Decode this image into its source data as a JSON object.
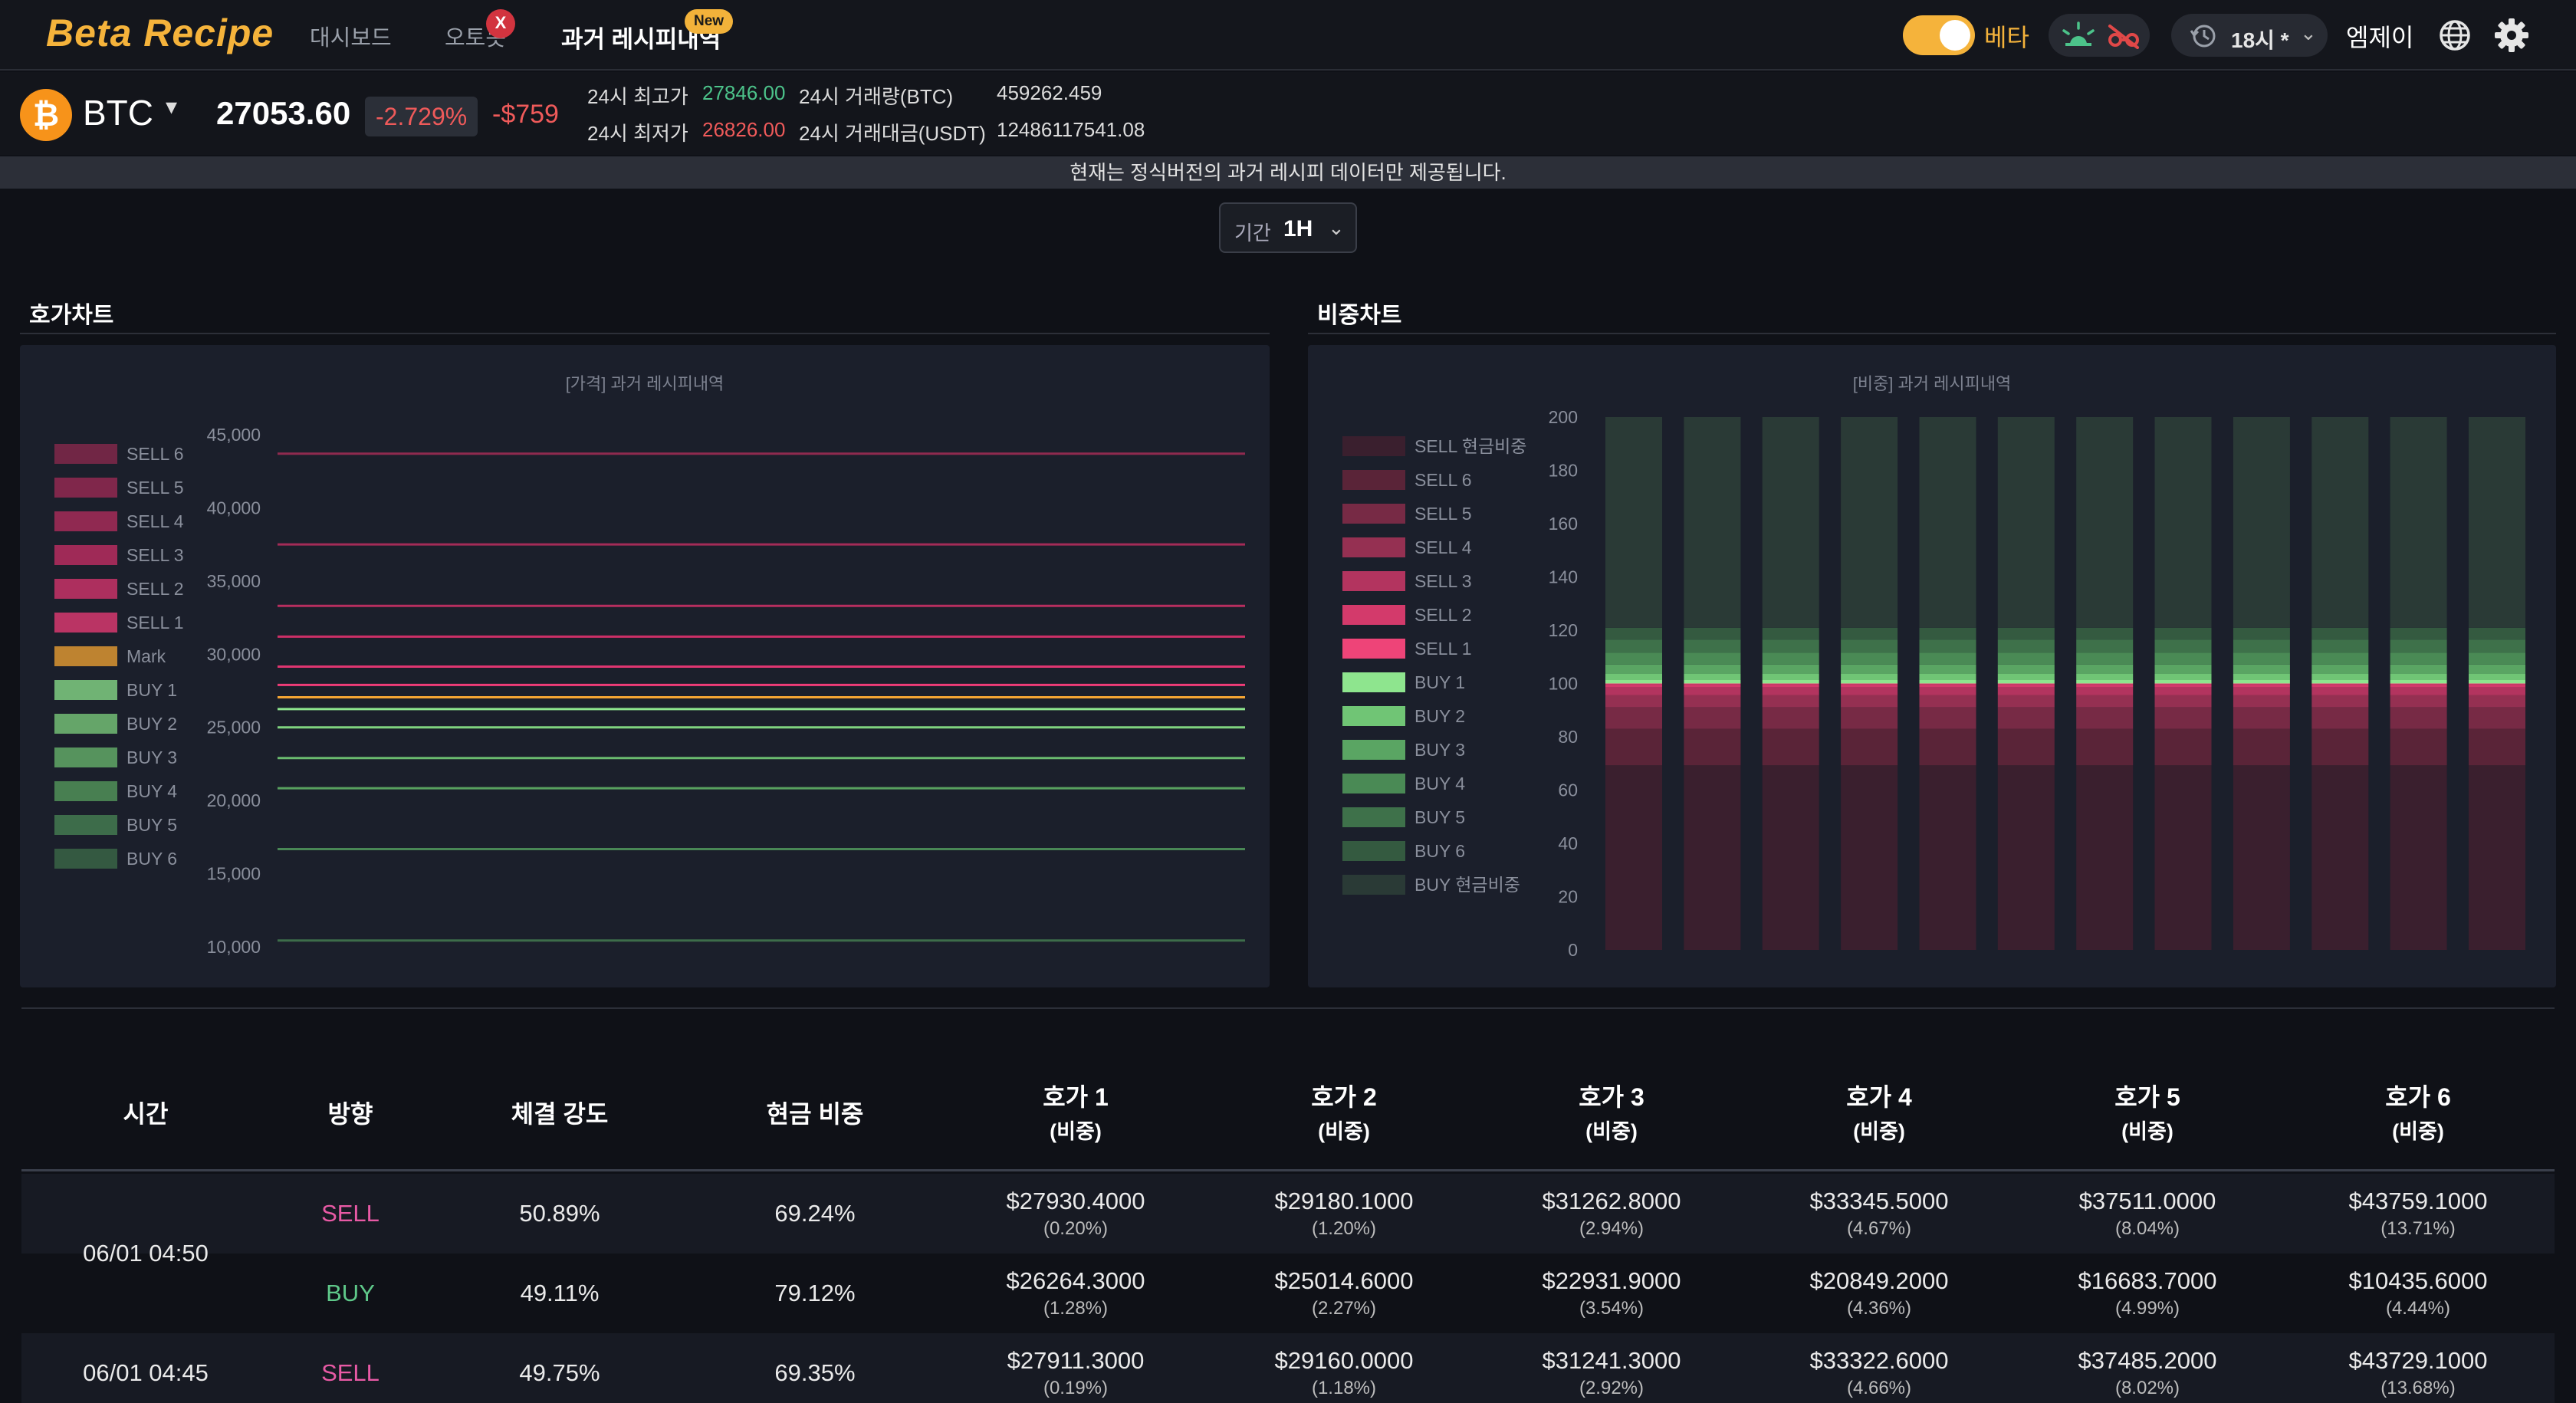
{
  "nav": {
    "logo": "Beta Recipe",
    "links": [
      "대시보드",
      "오토봇",
      "과거 레시피내역"
    ],
    "x_badge": "X",
    "new_badge": "New",
    "beta_label": "베타",
    "time_label": "18시 *",
    "user": "엠제이",
    "icons": [
      "alarm-icon",
      "glasses-off-icon",
      "history-clock-icon",
      "globe-icon",
      "gear-icon"
    ]
  },
  "ticker": {
    "coin_letter": "₿",
    "symbol": "BTC",
    "price": "27053.60",
    "change_pct": "-2.729%",
    "change_abs": "-$759",
    "stats": {
      "high_label": "24시 최고가",
      "high": "27846.00",
      "low_label": "24시 최저가",
      "low": "26826.00",
      "vol_label": "24시 거래량(BTC)",
      "vol": "459262.459",
      "amt_label": "24시 거래대금(USDT)",
      "amt": "12486117541.08"
    },
    "colors": {
      "up": "#4cc38a",
      "down": "#ef5a5a",
      "accent": "#f5b33b"
    }
  },
  "notice": "현재는 정식버전의 과거 레시피 데이터만 제공됩니다.",
  "period": {
    "label": "기간",
    "value": "1H"
  },
  "sections": {
    "left_title": "호가차트",
    "right_title": "비중차트"
  },
  "chart_data": [
    {
      "type": "line",
      "title": "[가격] 과거 레시피내역",
      "ylim": [
        10000,
        45000
      ],
      "y_ticks": [
        "45,000",
        "40,000",
        "35,000",
        "30,000",
        "25,000",
        "20,000",
        "15,000",
        "10,000"
      ],
      "x_count": 12,
      "series": [
        {
          "name": "SELL 6",
          "color": "#8f2a4f",
          "value": 43700
        },
        {
          "name": "SELL 5",
          "color": "#a32b57",
          "value": 37500
        },
        {
          "name": "SELL 4",
          "color": "#b82e5f",
          "value": 33300
        },
        {
          "name": "SELL 3",
          "color": "#cc2f67",
          "value": 31200
        },
        {
          "name": "SELL 2",
          "color": "#df3570",
          "value": 29150
        },
        {
          "name": "SELL 1",
          "color": "#f03c78",
          "value": 27900
        },
        {
          "name": "Mark",
          "color": "#f5a533",
          "value": 27053
        },
        {
          "name": "BUY 1",
          "color": "#8ee58e",
          "value": 26250
        },
        {
          "name": "BUY 2",
          "color": "#7fd37f",
          "value": 25000
        },
        {
          "name": "BUY 3",
          "color": "#6bbb6f",
          "value": 22900
        },
        {
          "name": "BUY 4",
          "color": "#58a05f",
          "value": 20840
        },
        {
          "name": "BUY 5",
          "color": "#498755",
          "value": 16680
        },
        {
          "name": "BUY 6",
          "color": "#3d6d4a",
          "value": 10430
        }
      ]
    },
    {
      "type": "bar",
      "stacked": true,
      "title": "[비중] 과거 레시피내역",
      "ylim": [
        0,
        200
      ],
      "y_ticks": [
        "200",
        "180",
        "160",
        "140",
        "120",
        "100",
        "80",
        "60",
        "40",
        "20",
        "0"
      ],
      "bar_count": 12,
      "series": [
        {
          "name": "SELL 현금비중",
          "color": "#3a1f2e",
          "value": 69.3
        },
        {
          "name": "SELL 6",
          "color": "#5a2438",
          "value": 13.7
        },
        {
          "name": "SELL 5",
          "color": "#772a45",
          "value": 8.0
        },
        {
          "name": "SELL 4",
          "color": "#953052",
          "value": 4.7
        },
        {
          "name": "SELL 3",
          "color": "#b3345f",
          "value": 2.9
        },
        {
          "name": "SELL 2",
          "color": "#d33a6b",
          "value": 1.2
        },
        {
          "name": "SELL 1",
          "color": "#ee4478",
          "value": 0.2
        },
        {
          "name": "BUY 1",
          "color": "#8ee58e",
          "value": 1.3
        },
        {
          "name": "BUY 2",
          "color": "#70c575",
          "value": 2.3
        },
        {
          "name": "BUY 3",
          "color": "#5aa563",
          "value": 3.5
        },
        {
          "name": "BUY 4",
          "color": "#4a8a55",
          "value": 4.4
        },
        {
          "name": "BUY 5",
          "color": "#3e714a",
          "value": 5.0
        },
        {
          "name": "BUY 6",
          "color": "#345a40",
          "value": 4.4
        },
        {
          "name": "BUY 현금비중",
          "color": "#2a3a36",
          "value": 79.1
        }
      ]
    }
  ],
  "table": {
    "headers": [
      {
        "label": "시간",
        "sub": ""
      },
      {
        "label": "방향",
        "sub": ""
      },
      {
        "label": "체결 강도",
        "sub": ""
      },
      {
        "label": "현금 비중",
        "sub": ""
      },
      {
        "label": "호가 1",
        "sub": "(비중)"
      },
      {
        "label": "호가 2",
        "sub": "(비중)"
      },
      {
        "label": "호가 3",
        "sub": "(비중)"
      },
      {
        "label": "호가 4",
        "sub": "(비중)"
      },
      {
        "label": "호가 5",
        "sub": "(비중)"
      },
      {
        "label": "호가 6",
        "sub": "(비중)"
      }
    ],
    "groups": [
      {
        "time": "06/01 04:50",
        "rows": [
          {
            "dir": "SELL",
            "strength": "50.89%",
            "cash": "69.24%",
            "levels": [
              [
                "$27930.4000",
                "(0.20%)"
              ],
              [
                "$29180.1000",
                "(1.20%)"
              ],
              [
                "$31262.8000",
                "(2.94%)"
              ],
              [
                "$33345.5000",
                "(4.67%)"
              ],
              [
                "$37511.0000",
                "(8.04%)"
              ],
              [
                "$43759.1000",
                "(13.71%)"
              ]
            ]
          },
          {
            "dir": "BUY",
            "strength": "49.11%",
            "cash": "79.12%",
            "levels": [
              [
                "$26264.3000",
                "(1.28%)"
              ],
              [
                "$25014.6000",
                "(2.27%)"
              ],
              [
                "$22931.9000",
                "(3.54%)"
              ],
              [
                "$20849.2000",
                "(4.36%)"
              ],
              [
                "$16683.7000",
                "(4.99%)"
              ],
              [
                "$10435.6000",
                "(4.44%)"
              ]
            ]
          }
        ]
      },
      {
        "time": "06/01 04:45",
        "rows": [
          {
            "dir": "SELL",
            "strength": "49.75%",
            "cash": "69.35%",
            "levels": [
              [
                "$27911.3000",
                "(0.19%)"
              ],
              [
                "$29160.0000",
                "(1.18%)"
              ],
              [
                "$31241.3000",
                "(2.92%)"
              ],
              [
                "$33322.6000",
                "(4.66%)"
              ],
              [
                "$37485.2000",
                "(8.02%)"
              ],
              [
                "$43729.1000",
                "(13.68%)"
              ]
            ]
          }
        ]
      }
    ]
  }
}
